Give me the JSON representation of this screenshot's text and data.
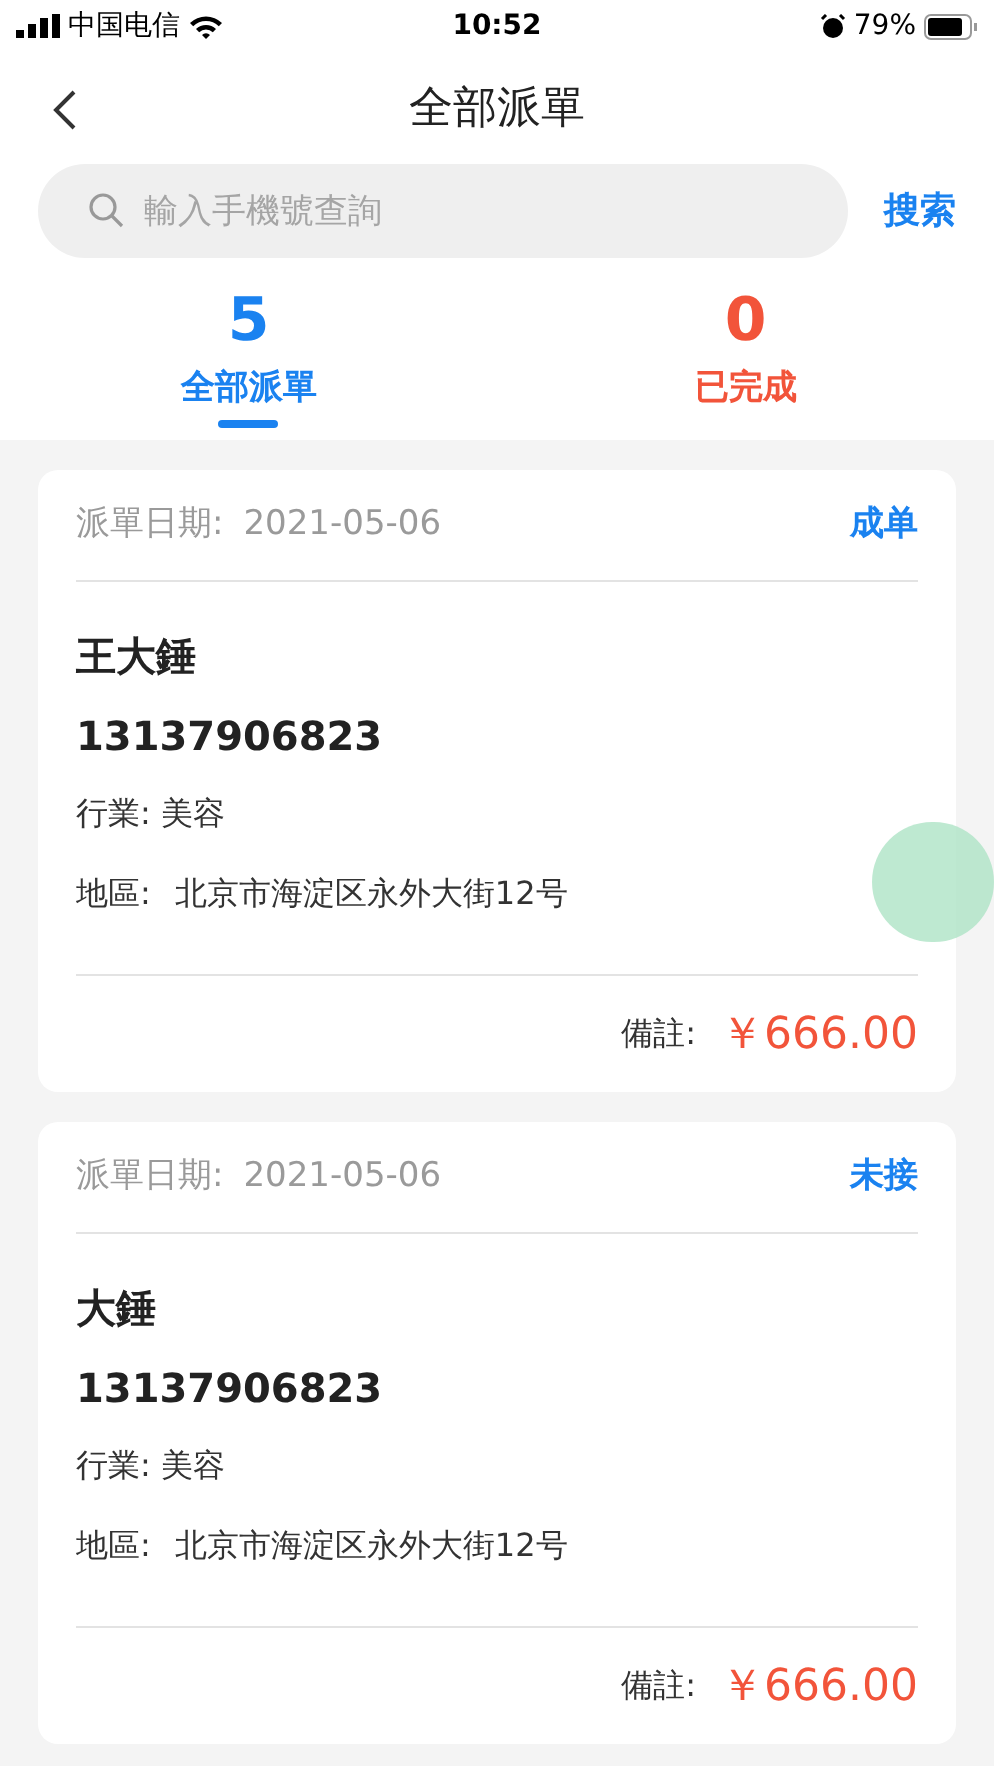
{
  "status_bar": {
    "carrier": "中国电信",
    "time": "10:52",
    "battery": "79%"
  },
  "nav": {
    "title": "全部派單"
  },
  "search": {
    "placeholder": "輸入手機號查詢",
    "button": "搜索"
  },
  "tabs": [
    {
      "count": "5",
      "label": "全部派單",
      "color": "#1a82f0",
      "selected": true
    },
    {
      "count": "0",
      "label": "已完成",
      "color": "#f2543a",
      "selected": false
    }
  ],
  "orders": [
    {
      "date_label": "派單日期:",
      "date": "2021-05-06",
      "status": "成单",
      "name": "王大錘",
      "phone": "13137906823",
      "industry": "行業: 美容",
      "region_label": "地區:",
      "region": "北京市海淀区永外大街12号",
      "note_label": "備註:",
      "amount": "￥666.00"
    },
    {
      "date_label": "派單日期:",
      "date": "2021-05-06",
      "status": "未接",
      "name": "大錘",
      "phone": "13137906823",
      "industry": "行業: 美容",
      "region_label": "地區:",
      "region": "北京市海淀区永外大街12号",
      "note_label": "備註:",
      "amount": "￥666.00"
    }
  ]
}
